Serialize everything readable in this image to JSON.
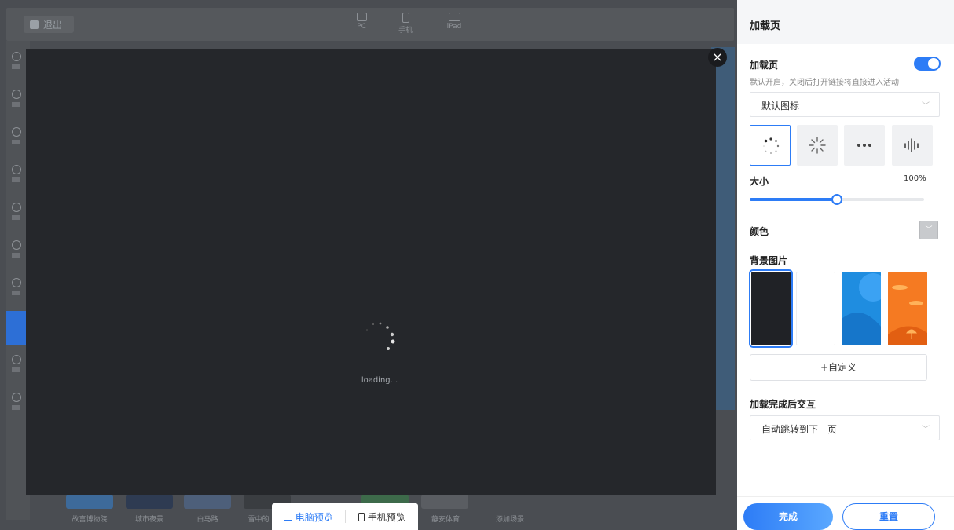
{
  "topbar": {
    "exit_label": "退出",
    "devices": [
      {
        "label": "PC",
        "icon": "monitor-icon"
      },
      {
        "label": "手机",
        "icon": "phone-icon"
      },
      {
        "label": "iPad",
        "icon": "tablet-icon"
      }
    ]
  },
  "bottom_scenes": [
    "故宫博物院",
    "城市夜景",
    "白马路",
    "雪中的",
    "静安体育",
    "添加场景"
  ],
  "preview": {
    "loading_text": "loading...",
    "switch": {
      "pc_label": "电脑预览",
      "mobile_label": "手机预览",
      "active": "pc"
    }
  },
  "panel": {
    "header": "加载页",
    "loading_page": {
      "title": "加载页",
      "hint": "默认开启，关闭后打开链接将直接进入活动",
      "enabled": true
    },
    "icon_select": {
      "value": "默认图标"
    },
    "icon_options": [
      "spinner-dots-icon",
      "spinner-lines-icon",
      "ellipsis-icon",
      "bars-icon"
    ],
    "size": {
      "label": "大小",
      "value_text": "100%",
      "value": 0.5
    },
    "color": {
      "label": "颜色"
    },
    "background": {
      "label": "背景图片",
      "thumbs": [
        "#202226",
        "#ffffff",
        "#1f8de0",
        "#f57a22"
      ],
      "custom_label": "+自定义"
    },
    "after_load": {
      "label": "加载完成后交互",
      "value": "自动跳转到下一页"
    },
    "done_label": "完成",
    "reset_label": "重置"
  },
  "colors": {
    "accent": "#2d7cf6"
  }
}
